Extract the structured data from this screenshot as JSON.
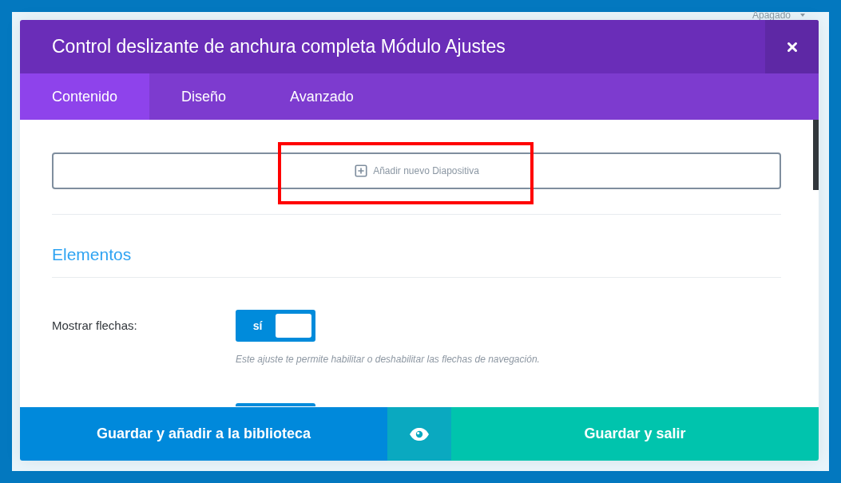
{
  "background": {
    "dropdown_value": "Apagado"
  },
  "modal": {
    "title": "Control deslizante de anchura completa Módulo Ajustes",
    "tabs": [
      {
        "label": "Contenido",
        "selected": true
      },
      {
        "label": "Diseño",
        "selected": false
      },
      {
        "label": "Avanzado",
        "selected": false
      }
    ],
    "add_slide_button": {
      "label": "Añadir nuevo Diapositiva",
      "highlighted": true
    },
    "section": {
      "title": "Elementos"
    },
    "settings": [
      {
        "kind": "toggle",
        "label": "Mostrar flechas:",
        "on": true,
        "state_label": "sí",
        "help": "Este ajuste te permite habilitar o deshabilitar las flechas de navegación."
      },
      {
        "kind": "toggle-peek",
        "on": true
      }
    ],
    "footer": [
      {
        "kind": "save-library",
        "label": "Guardar y añadir a la biblioteca"
      },
      {
        "kind": "preview"
      },
      {
        "kind": "save-exit",
        "label": "Guardar y salir"
      }
    ]
  }
}
